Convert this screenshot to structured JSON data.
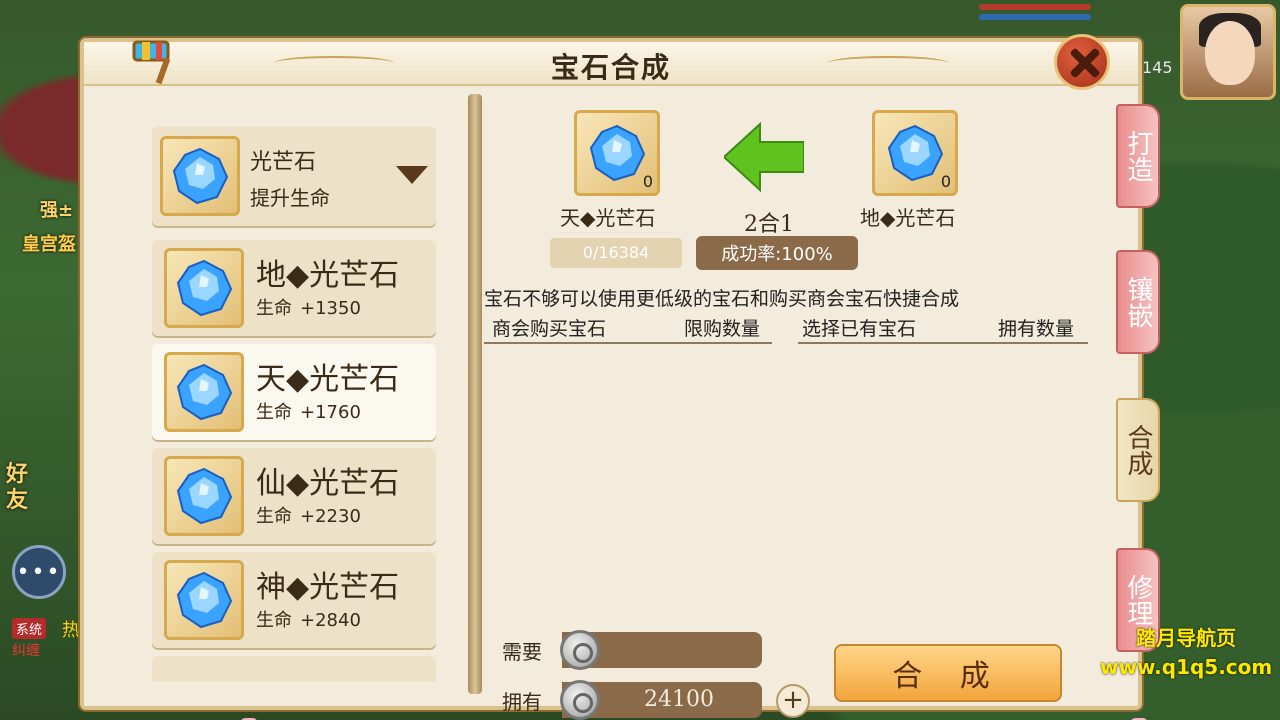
{
  "background": {
    "player_level": "145",
    "guild_left_text": "强±",
    "guild_text": "皇宫盔",
    "friend_text": "好友",
    "chat_icon": "chat-bubble-icon",
    "system_tag": "系统",
    "hot_text": "热",
    "line2_text": "纠缠"
  },
  "window": {
    "title": "宝石合成"
  },
  "selector": {
    "name": "光芒石",
    "subtitle": "提升生命"
  },
  "gem_list": [
    {
      "name": "地◆光芒石",
      "stat_label": "生命",
      "stat_value": "+1350"
    },
    {
      "name": "天◆光芒石",
      "stat_label": "生命",
      "stat_value": "+1760"
    },
    {
      "name": "仙◆光芒石",
      "stat_label": "生命",
      "stat_value": "+2230"
    },
    {
      "name": "神◆光芒石",
      "stat_label": "生命",
      "stat_value": "+2840"
    }
  ],
  "synthesis": {
    "target_name": "天◆光芒石",
    "target_count": "0",
    "source_name": "地◆光芒石",
    "source_count": "0",
    "ratio": "2合1",
    "progress_text": "0/16384",
    "progress_fraction": 0,
    "success_rate": "成功率:100%",
    "hint": "宝石不够可以使用更低级的宝石和购买商会宝石快捷合成",
    "col_buy": "商会购买宝石",
    "col_limit": "限购数量",
    "col_select": "选择已有宝石",
    "col_owned": "拥有数量",
    "need_label": "需要",
    "own_label": "拥有",
    "own_value": "24100",
    "synth_button": "合 成"
  },
  "side_tabs": {
    "forge": "打造",
    "inlay": "镶嵌",
    "synth": "合成",
    "repair": "修理"
  },
  "watermark": {
    "line1": "踏月导航页",
    "line2": "www.q1q5.com"
  },
  "colors": {
    "panel_bg": "#f3ecdc",
    "gem_blue": "#3aa3ff",
    "arrow_green": "#5fc21e",
    "tab_pink": "#e98d8d",
    "button_orange": "#f2a53c"
  }
}
